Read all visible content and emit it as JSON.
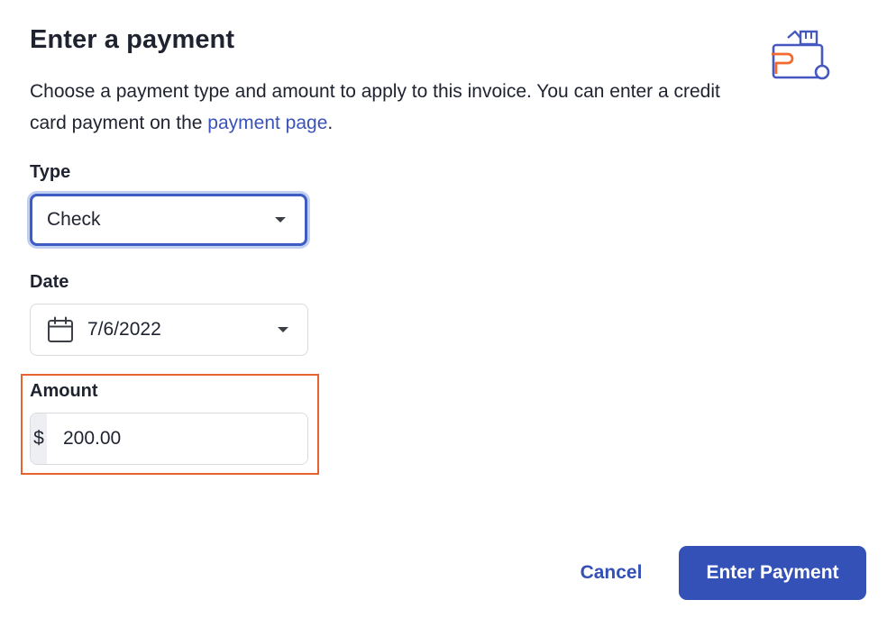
{
  "dialog": {
    "title": "Enter a payment",
    "description_prefix": "Choose a payment type and amount to apply to this invoice. You can enter a credit card payment on the ",
    "description_link": "payment page",
    "description_suffix": ".",
    "icon": "wallet-icon"
  },
  "type_field": {
    "label": "Type",
    "value": "Check",
    "icon": "caret-down-icon"
  },
  "date_field": {
    "label": "Date",
    "value": "7/6/2022",
    "icon": "calendar-icon"
  },
  "amount_field": {
    "label": "Amount",
    "prefix": "$",
    "value": "200.00"
  },
  "actions": {
    "cancel_label": "Cancel",
    "submit_label": "Enter Payment"
  },
  "colors": {
    "accent": "#3451b8",
    "link": "#3a53b8",
    "highlight": "#e8622e",
    "icon_orange": "#f26a2e"
  }
}
